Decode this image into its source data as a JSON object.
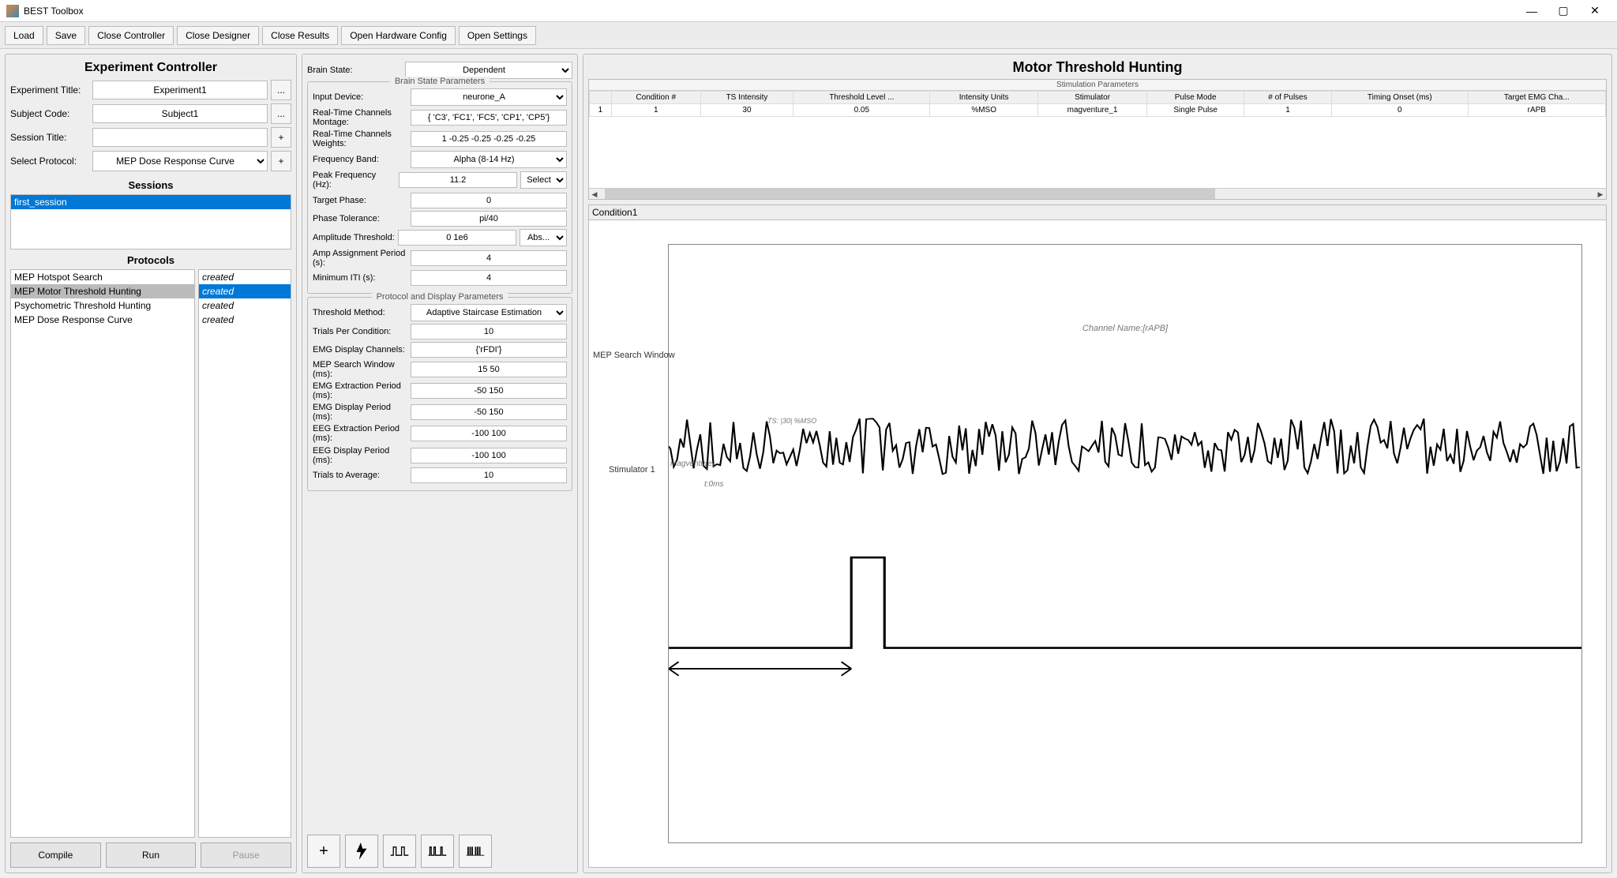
{
  "window": {
    "title": "BEST Toolbox"
  },
  "toolbar": {
    "load": "Load",
    "save": "Save",
    "close_controller": "Close Controller",
    "close_designer": "Close Designer",
    "close_results": "Close Results",
    "open_hw": "Open Hardware Config",
    "open_settings": "Open Settings"
  },
  "controller": {
    "title": "Experiment Controller",
    "exp_label": "Experiment Title:",
    "exp_value": "Experiment1",
    "subj_label": "Subject Code:",
    "subj_value": "Subject1",
    "sess_label": "Session Title:",
    "sess_value": "",
    "proto_label": "Select Protocol:",
    "proto_value": "MEP Dose Response Curve",
    "sessions_title": "Sessions",
    "sessions": [
      "first_session"
    ],
    "protocols_title": "Protocols",
    "protocols": [
      {
        "name": "MEP Hotspot Search",
        "status": "created",
        "sel": false
      },
      {
        "name": "MEP Motor Threshold Hunting",
        "status": "created",
        "sel": true
      },
      {
        "name": "Psychometric Threshold Hunting",
        "status": "created",
        "sel": false
      },
      {
        "name": "MEP Dose Response Curve",
        "status": "created",
        "sel": false
      }
    ],
    "compile": "Compile",
    "run": "Run",
    "pause": "Pause"
  },
  "mid": {
    "brain_state_label": "Brain State:",
    "brain_state_value": "Dependent",
    "bsp_title": "Brain State Parameters",
    "input_dev_label": "Input Device:",
    "input_dev_value": "neurone_A",
    "montage_label": "Real-Time Channels Montage:",
    "montage_value": "{ 'C3', 'FC1', 'FC5', 'CP1', 'CP5'}",
    "weights_label": "Real-Time Channels Weights:",
    "weights_value": "1 -0.25 -0.25 -0.25 -0.25",
    "freq_label": "Frequency Band:",
    "freq_value": "Alpha (8-14 Hz)",
    "peak_label": "Peak Frequency (Hz):",
    "peak_value": "11.2",
    "peak_mode": "Select",
    "phase_label": "Target Phase:",
    "phase_value": "0",
    "ptol_label": "Phase Tolerance:",
    "ptol_value": "pi/40",
    "amp_label": "Amplitude Threshold:",
    "amp_value": "0 1e6",
    "amp_mode": "Abs...",
    "aap_label": "Amp Assignment Period (s):",
    "aap_value": "4",
    "iti_label": "Minimum ITI (s):",
    "iti_value": "4",
    "pdp_title": "Protocol and Display Parameters",
    "thr_label": "Threshold Method:",
    "thr_value": "Adaptive Staircase Estimation",
    "tpc_label": "Trials Per Condition:",
    "tpc_value": "10",
    "emg_ch_label": "EMG Display Channels:",
    "emg_ch_value": "{'rFDI'}",
    "mep_sw_label": "MEP Search Window (ms):",
    "mep_sw_value": "15 50",
    "emg_ex_label": "EMG Extraction Period (ms):",
    "emg_ex_value": "-50 150",
    "emg_dp_label": "EMG Display Period (ms):",
    "emg_dp_value": "-50 150",
    "eeg_ex_label": "EEG Extraction Period (ms):",
    "eeg_ex_value": "-100 100",
    "eeg_dp_label": "EEG Display Period (ms):",
    "eeg_dp_value": "-100 100",
    "tta_label": "Trials to Average:",
    "tta_value": "10"
  },
  "right": {
    "title": "Motor Threshold Hunting",
    "stim_caption": "Stimulation Parameters",
    "cols": [
      "",
      "Condition #",
      "TS Intensity",
      "Threshold Level ...",
      "Intensity Units",
      "Stimulator",
      "Pulse Mode",
      "# of Pulses",
      "Timing Onset (ms)",
      "Target EMG Cha..."
    ],
    "row": [
      "1",
      "1",
      "30",
      "0.05",
      "%MSO",
      "magventure_1",
      "Single Pulse",
      "1",
      "0",
      "rAPB"
    ],
    "cond_label": "Condition1",
    "chan_name": "Channel Name:[rAPB]",
    "mep_axis": "MEP Search Window",
    "stim_axis": "Stimulator 1",
    "ts_label": "TS: |30| %MSO",
    "mag_label": "magventure₁",
    "t0_label": "t:0ms"
  }
}
